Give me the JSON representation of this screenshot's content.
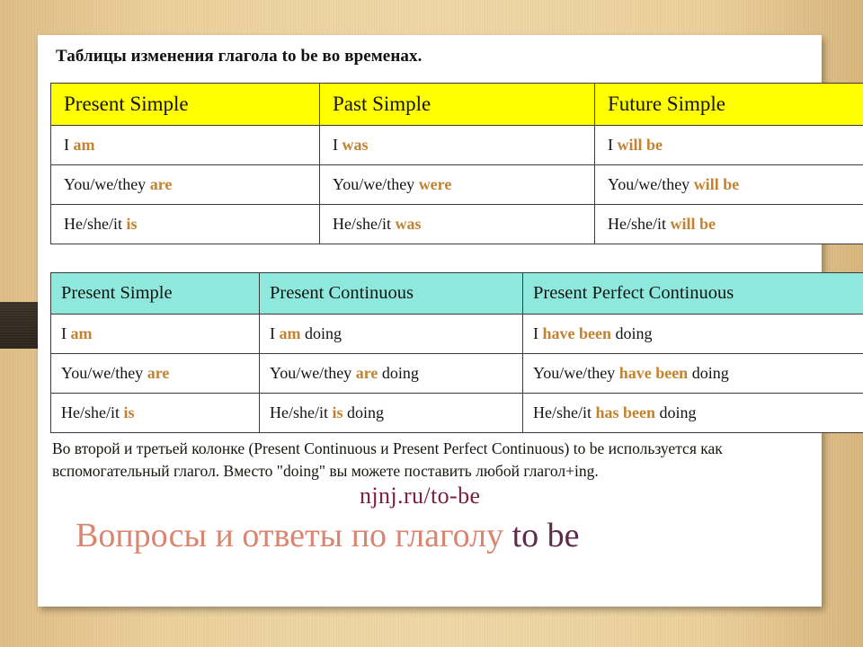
{
  "document": {
    "title": "Таблицы изменения глагола to be во временах."
  },
  "tables": [
    {
      "id": "tenses-basic",
      "header_color": "#ffff00",
      "headers": [
        "Present Simple",
        "Past Simple",
        "Future Simple"
      ],
      "rows": [
        [
          {
            "subject": "I",
            "verb": "am",
            "tail": ""
          },
          {
            "subject": "I",
            "verb": "was",
            "tail": ""
          },
          {
            "subject": "I",
            "verb": "will be",
            "tail": ""
          }
        ],
        [
          {
            "subject": "You/we/they",
            "verb": "are",
            "tail": ""
          },
          {
            "subject": "You/we/they",
            "verb": "were",
            "tail": ""
          },
          {
            "subject": "You/we/they",
            "verb": "will be",
            "tail": ""
          }
        ],
        [
          {
            "subject": "He/she/it",
            "verb": "is",
            "tail": ""
          },
          {
            "subject": "He/she/it",
            "verb": "was",
            "tail": ""
          },
          {
            "subject": "He/she/it",
            "verb": "will be",
            "tail": ""
          }
        ]
      ]
    },
    {
      "id": "tenses-continuous",
      "header_color": "#8ee8dc",
      "headers": [
        "Present Simple",
        "Present Continuous",
        "Present Perfect Continuous"
      ],
      "rows": [
        [
          {
            "subject": "I",
            "verb": "am",
            "tail": ""
          },
          {
            "subject": "I",
            "verb": "am",
            "tail": "doing"
          },
          {
            "subject": "I",
            "verb": "have been",
            "tail": "doing"
          }
        ],
        [
          {
            "subject": "You/we/they",
            "verb": "are",
            "tail": ""
          },
          {
            "subject": "You/we/they",
            "verb": "are",
            "tail": "doing"
          },
          {
            "subject": "You/we/they",
            "verb": "have been",
            "tail": "doing"
          }
        ],
        [
          {
            "subject": "He/she/it",
            "verb": "is",
            "tail": ""
          },
          {
            "subject": "He/she/it",
            "verb": "is",
            "tail": "doing"
          },
          {
            "subject": "He/she/it",
            "verb": "has been",
            "tail": "doing"
          }
        ]
      ]
    }
  ],
  "explanation": "Во второй и третьей колонке (Present Continuous и Present Perfect Continuous) to be используется как вспомогательный глагол. Вместо \"doing\" вы можете поставить любой глагол+ing.",
  "watermark": "njnj.ru/to-be",
  "big_heading": {
    "text": "Вопросы и ответы по глаголу",
    "accent": "to be"
  },
  "colors": {
    "verb_highlight": "#c4822f",
    "header_yellow": "#ffff00",
    "header_teal": "#8ee8dc",
    "watermark": "#7d1f3d",
    "heading_main": "#d98570",
    "heading_accent": "#5c2a4a",
    "background_wood": "#e8c88e",
    "wood_band": "#332b20"
  }
}
